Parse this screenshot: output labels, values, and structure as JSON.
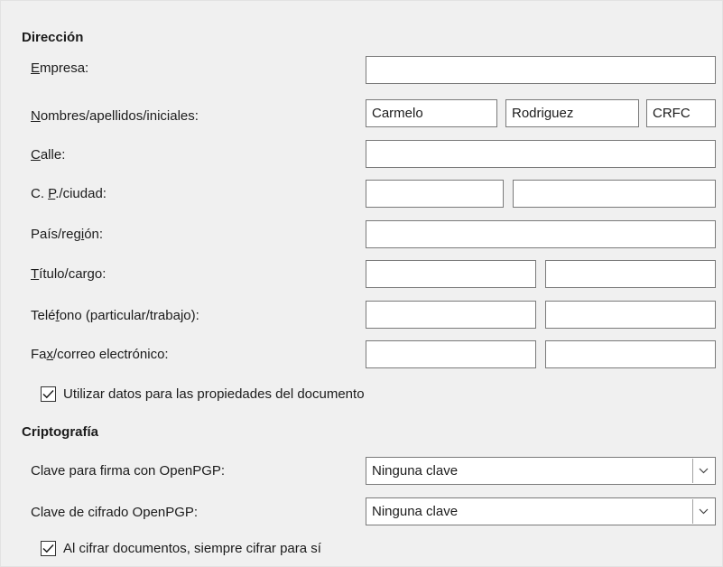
{
  "address": {
    "title": "Dirección",
    "company": {
      "pre": "",
      "key": "E",
      "post": "mpresa:",
      "value": ""
    },
    "names": {
      "pre": "",
      "key": "N",
      "post": "ombres/apellidos/iniciales:",
      "first": "Carmelo",
      "last": "Rodriguez",
      "initials": "CRFC"
    },
    "street": {
      "pre": "",
      "key": "C",
      "post": "alle:",
      "value": ""
    },
    "zip_city": {
      "pre": "C. ",
      "key": "P",
      "post": "./ciudad:",
      "zip": "",
      "city": ""
    },
    "country": {
      "pre": "País/reg",
      "key": "i",
      "post": "ón:",
      "value": ""
    },
    "title_position": {
      "pre": "",
      "key": "T",
      "post": "ítulo/cargo:",
      "title": "",
      "position": ""
    },
    "phone": {
      "pre": "Telé",
      "key": "f",
      "post": "ono (particular/trabajo):",
      "home": "",
      "work": ""
    },
    "fax_email": {
      "pre": "Fa",
      "key": "x",
      "post": "/correo electrónico:",
      "fax": "",
      "email": ""
    },
    "use_data": {
      "label": "Utilizar datos para las propiedades del documento",
      "checked": true
    }
  },
  "crypto": {
    "title": "Criptografía",
    "signing_key": {
      "label": "Clave para firma con OpenPGP:",
      "value": "Ninguna clave"
    },
    "encryption_key": {
      "label": "Clave de cifrado OpenPGP:",
      "value": "Ninguna clave"
    },
    "encrypt_to_self": {
      "label": "Al cifrar documentos, siempre cifrar para sí",
      "checked": true
    }
  },
  "icons": {
    "check": "checkmark-icon",
    "dropdown": "chevron-down-icon"
  }
}
